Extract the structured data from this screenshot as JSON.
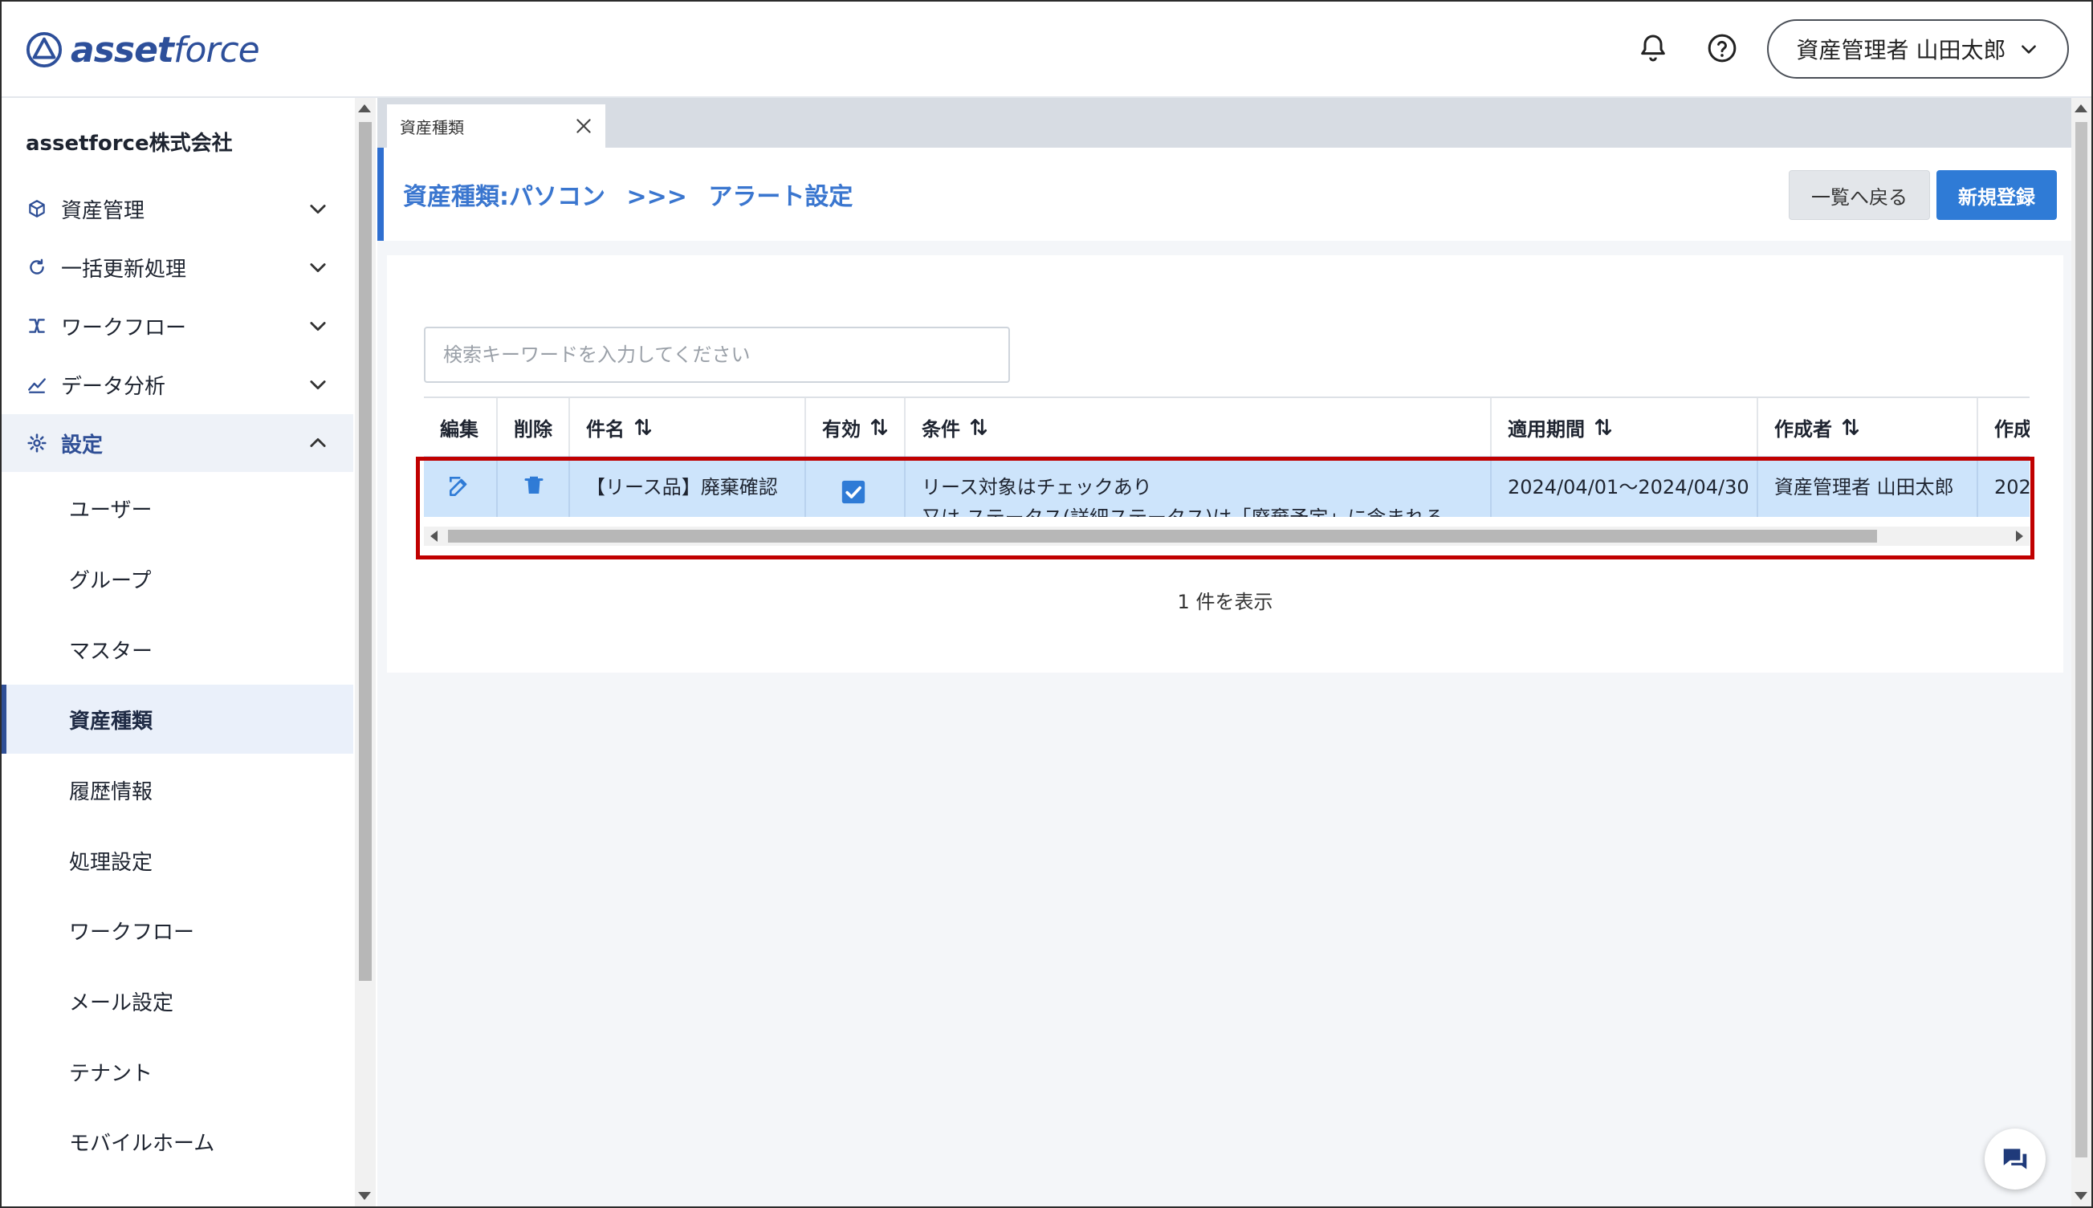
{
  "app": {
    "logo_text_bold": "asset",
    "logo_text_light": "force",
    "user_label": "資産管理者 山田太郎"
  },
  "sidebar": {
    "company": "assetforce株式会社",
    "items": [
      {
        "label": "資産管理",
        "icon": "cube-icon"
      },
      {
        "label": "一括更新処理",
        "icon": "refresh-icon"
      },
      {
        "label": "ワークフロー",
        "icon": "workflow-icon"
      },
      {
        "label": "データ分析",
        "icon": "chart-icon"
      },
      {
        "label": "設定",
        "icon": "gear-icon"
      }
    ],
    "settings_sub": [
      {
        "label": "ユーザー"
      },
      {
        "label": "グループ"
      },
      {
        "label": "マスター"
      },
      {
        "label": "資産種類"
      },
      {
        "label": "履歴情報"
      },
      {
        "label": "処理設定"
      },
      {
        "label": "ワークフロー"
      },
      {
        "label": "メール設定"
      },
      {
        "label": "テナント"
      },
      {
        "label": "モバイルホーム"
      }
    ]
  },
  "tab": {
    "label": "資産種類"
  },
  "breadcrumb": {
    "part1": "資産種類:パソコン",
    "sep": ">>>",
    "part2": "アラート設定"
  },
  "buttons": {
    "back": "一覧へ戻る",
    "new": "新規登録"
  },
  "search": {
    "placeholder": "検索キーワードを入力してください"
  },
  "table": {
    "columns": [
      "編集",
      "削除",
      "件名",
      "有効",
      "条件",
      "適用期間",
      "作成者",
      "作成"
    ],
    "rows": [
      {
        "subject": "【リース品】廃棄確認",
        "enabled": true,
        "condition_line1": "リース対象はチェックあり",
        "condition_line2": "又は ステータス(詳細ステータス)は「廃棄予定」に含まれる",
        "period": "2024/04/01～2024/04/30",
        "creator": "資産管理者 山田太郎",
        "created_partial": "202"
      }
    ]
  },
  "footer": {
    "count_text": "1 件を表示"
  },
  "colors": {
    "accent": "#2f7bd6",
    "brand": "#2d4f9a",
    "row_highlight": "#cde4fb",
    "annotation_box": "#c00000"
  }
}
